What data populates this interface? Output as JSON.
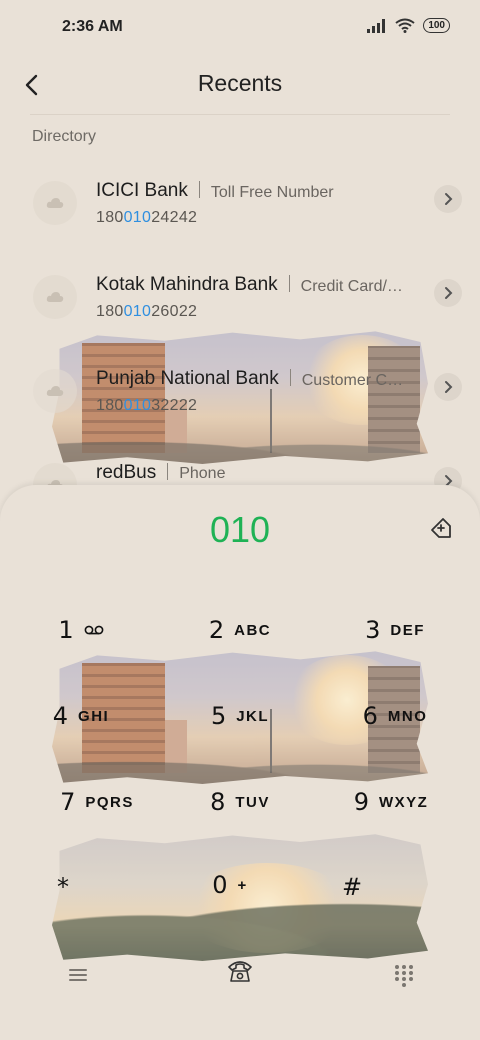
{
  "status": {
    "time": "2:36 AM",
    "battery": "100"
  },
  "header": {
    "title": "Recents"
  },
  "section_label": "Directory",
  "contacts": [
    {
      "name": "ICICI Bank",
      "subtitle": "Toll Free Number",
      "num_pre": "180",
      "num_hl": "010",
      "num_post": "24242"
    },
    {
      "name": "Kotak Mahindra Bank",
      "subtitle": "Credit Card/…",
      "num_pre": "180",
      "num_hl": "010",
      "num_post": "26022"
    },
    {
      "name": "Punjab National Bank",
      "subtitle": "Customer C…",
      "num_pre": "180",
      "num_hl": "010",
      "num_post": "32222"
    },
    {
      "name": "redBus",
      "subtitle": "Phone",
      "num_pre": "",
      "num_hl": "",
      "num_post": ""
    }
  ],
  "dialer": {
    "digits": "010",
    "keys": [
      {
        "digit": "1",
        "letters": ""
      },
      {
        "digit": "2",
        "letters": "ABC"
      },
      {
        "digit": "3",
        "letters": "DEF"
      },
      {
        "digit": "4",
        "letters": "GHI"
      },
      {
        "digit": "5",
        "letters": "JKL"
      },
      {
        "digit": "6",
        "letters": "MNO"
      },
      {
        "digit": "7",
        "letters": "PQRS"
      },
      {
        "digit": "8",
        "letters": "TUV"
      },
      {
        "digit": "9",
        "letters": "WXYZ"
      },
      {
        "digit": "*",
        "letters": ""
      },
      {
        "digit": "0",
        "letters": "+"
      },
      {
        "digit": "#",
        "letters": ""
      }
    ]
  },
  "colors": {
    "highlight": "#2f8fe0",
    "dialed": "#1fb255",
    "background": "#e9e1d7"
  },
  "icons": {
    "back": "back-arrow-icon",
    "contact_avatar": "cloud-icon",
    "contact_action": "chevron-right-icon",
    "voicemail": "voicemail-icon",
    "tag": "tag-plus-icon",
    "menu": "menu-icon",
    "call": "phone-icon",
    "keypad": "keypad-icon"
  }
}
